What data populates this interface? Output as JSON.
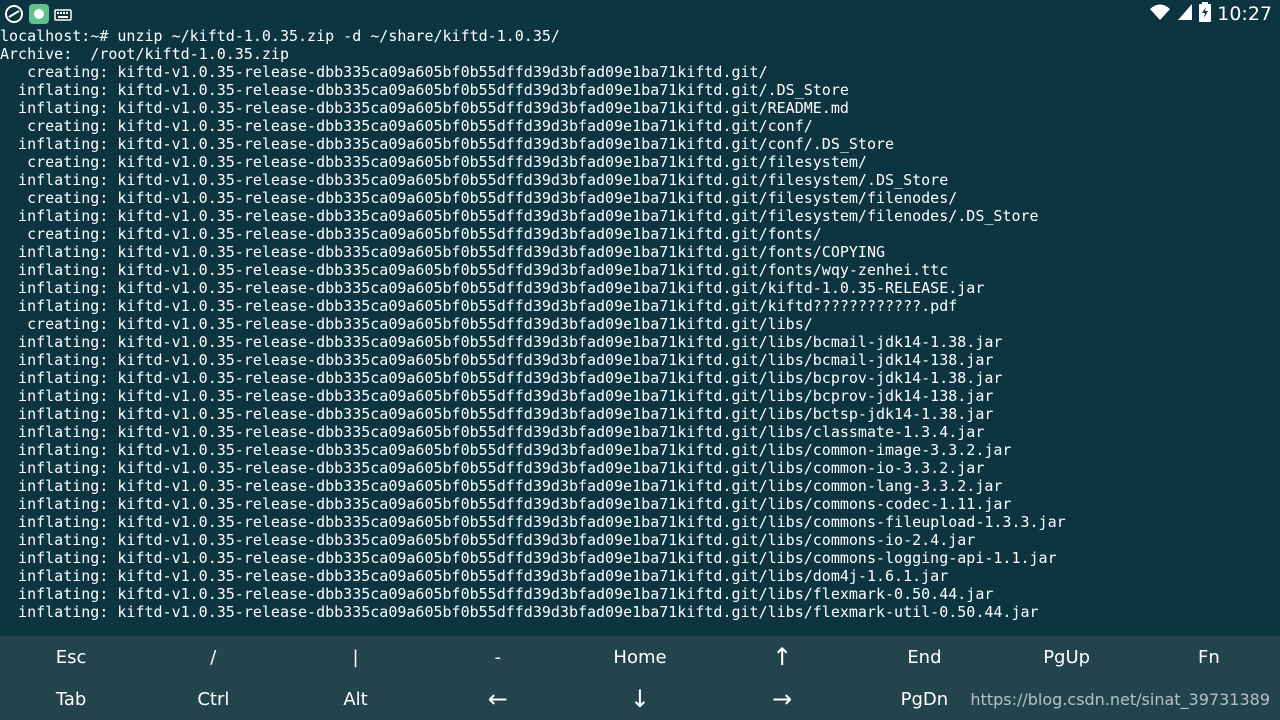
{
  "status_bar": {
    "time": "10:27",
    "icons": [
      "android-debug-icon",
      "app-notification-icon",
      "keyboard-icon",
      "wifi-icon",
      "signal-icon",
      "battery-icon"
    ]
  },
  "terminal": {
    "lines": [
      "localhost:~# unzip ~/kiftd-1.0.35.zip -d ~/share/kiftd-1.0.35/",
      "Archive:  /root/kiftd-1.0.35.zip",
      "   creating: kiftd-v1.0.35-release-dbb335ca09a605bf0b55dffd39d3bfad09e1ba71kiftd.git/",
      "  inflating: kiftd-v1.0.35-release-dbb335ca09a605bf0b55dffd39d3bfad09e1ba71kiftd.git/.DS_Store",
      "  inflating: kiftd-v1.0.35-release-dbb335ca09a605bf0b55dffd39d3bfad09e1ba71kiftd.git/README.md",
      "   creating: kiftd-v1.0.35-release-dbb335ca09a605bf0b55dffd39d3bfad09e1ba71kiftd.git/conf/",
      "  inflating: kiftd-v1.0.35-release-dbb335ca09a605bf0b55dffd39d3bfad09e1ba71kiftd.git/conf/.DS_Store",
      "   creating: kiftd-v1.0.35-release-dbb335ca09a605bf0b55dffd39d3bfad09e1ba71kiftd.git/filesystem/",
      "  inflating: kiftd-v1.0.35-release-dbb335ca09a605bf0b55dffd39d3bfad09e1ba71kiftd.git/filesystem/.DS_Store",
      "   creating: kiftd-v1.0.35-release-dbb335ca09a605bf0b55dffd39d3bfad09e1ba71kiftd.git/filesystem/filenodes/",
      "  inflating: kiftd-v1.0.35-release-dbb335ca09a605bf0b55dffd39d3bfad09e1ba71kiftd.git/filesystem/filenodes/.DS_Store",
      "   creating: kiftd-v1.0.35-release-dbb335ca09a605bf0b55dffd39d3bfad09e1ba71kiftd.git/fonts/",
      "  inflating: kiftd-v1.0.35-release-dbb335ca09a605bf0b55dffd39d3bfad09e1ba71kiftd.git/fonts/COPYING",
      "  inflating: kiftd-v1.0.35-release-dbb335ca09a605bf0b55dffd39d3bfad09e1ba71kiftd.git/fonts/wqy-zenhei.ttc",
      "  inflating: kiftd-v1.0.35-release-dbb335ca09a605bf0b55dffd39d3bfad09e1ba71kiftd.git/kiftd-1.0.35-RELEASE.jar",
      "  inflating: kiftd-v1.0.35-release-dbb335ca09a605bf0b55dffd39d3bfad09e1ba71kiftd.git/kiftd????????????.pdf",
      "   creating: kiftd-v1.0.35-release-dbb335ca09a605bf0b55dffd39d3bfad09e1ba71kiftd.git/libs/",
      "  inflating: kiftd-v1.0.35-release-dbb335ca09a605bf0b55dffd39d3bfad09e1ba71kiftd.git/libs/bcmail-jdk14-1.38.jar",
      "  inflating: kiftd-v1.0.35-release-dbb335ca09a605bf0b55dffd39d3bfad09e1ba71kiftd.git/libs/bcmail-jdk14-138.jar",
      "  inflating: kiftd-v1.0.35-release-dbb335ca09a605bf0b55dffd39d3bfad09e1ba71kiftd.git/libs/bcprov-jdk14-1.38.jar",
      "  inflating: kiftd-v1.0.35-release-dbb335ca09a605bf0b55dffd39d3bfad09e1ba71kiftd.git/libs/bcprov-jdk14-138.jar",
      "  inflating: kiftd-v1.0.35-release-dbb335ca09a605bf0b55dffd39d3bfad09e1ba71kiftd.git/libs/bctsp-jdk14-1.38.jar",
      "  inflating: kiftd-v1.0.35-release-dbb335ca09a605bf0b55dffd39d3bfad09e1ba71kiftd.git/libs/classmate-1.3.4.jar",
      "  inflating: kiftd-v1.0.35-release-dbb335ca09a605bf0b55dffd39d3bfad09e1ba71kiftd.git/libs/common-image-3.3.2.jar",
      "  inflating: kiftd-v1.0.35-release-dbb335ca09a605bf0b55dffd39d3bfad09e1ba71kiftd.git/libs/common-io-3.3.2.jar",
      "  inflating: kiftd-v1.0.35-release-dbb335ca09a605bf0b55dffd39d3bfad09e1ba71kiftd.git/libs/common-lang-3.3.2.jar",
      "  inflating: kiftd-v1.0.35-release-dbb335ca09a605bf0b55dffd39d3bfad09e1ba71kiftd.git/libs/commons-codec-1.11.jar",
      "  inflating: kiftd-v1.0.35-release-dbb335ca09a605bf0b55dffd39d3bfad09e1ba71kiftd.git/libs/commons-fileupload-1.3.3.jar",
      "  inflating: kiftd-v1.0.35-release-dbb335ca09a605bf0b55dffd39d3bfad09e1ba71kiftd.git/libs/commons-io-2.4.jar",
      "  inflating: kiftd-v1.0.35-release-dbb335ca09a605bf0b55dffd39d3bfad09e1ba71kiftd.git/libs/commons-logging-api-1.1.jar",
      "  inflating: kiftd-v1.0.35-release-dbb335ca09a605bf0b55dffd39d3bfad09e1ba71kiftd.git/libs/dom4j-1.6.1.jar",
      "  inflating: kiftd-v1.0.35-release-dbb335ca09a605bf0b55dffd39d3bfad09e1ba71kiftd.git/libs/flexmark-0.50.44.jar",
      "  inflating: kiftd-v1.0.35-release-dbb335ca09a605bf0b55dffd39d3bfad09e1ba71kiftd.git/libs/flexmark-util-0.50.44.jar"
    ]
  },
  "extra_keys": {
    "row1": [
      "Esc",
      "/",
      "|",
      "-",
      "Home",
      "↑",
      "End",
      "PgUp",
      "Fn"
    ],
    "row2": [
      "Tab",
      "Ctrl",
      "Alt",
      "←",
      "↓",
      "→",
      "PgDn"
    ]
  },
  "watermark": "https://blog.csdn.net/sinat_39731389"
}
